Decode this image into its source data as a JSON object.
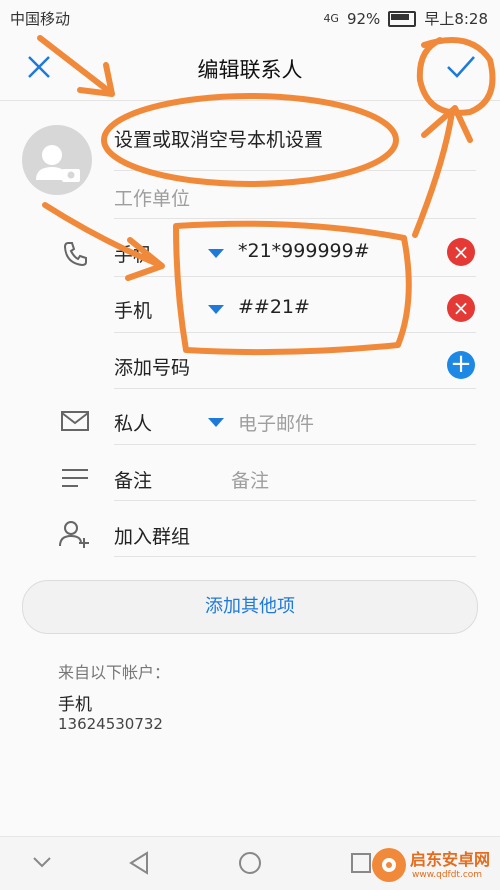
{
  "status_bar": {
    "carrier": "中国移动",
    "network": "4G",
    "battery": "92%",
    "time": "早上8:28"
  },
  "header": {
    "title": "编辑联系人"
  },
  "form": {
    "name_value": "设置或取消空号本机设置",
    "company_placeholder": "工作单位",
    "phones": [
      {
        "type": "手机",
        "number": "*21*999999#"
      },
      {
        "type": "手机",
        "number": "##21#"
      }
    ],
    "add_number_label": "添加号码",
    "email": {
      "type": "私人",
      "placeholder": "电子邮件"
    },
    "note": {
      "label": "备注",
      "placeholder": "备注"
    },
    "group_label": "加入群组",
    "add_other_label": "添加其他项"
  },
  "account": {
    "heading": "来自以下帐户：",
    "type": "手机",
    "number": "13624530732"
  },
  "watermark": {
    "brand": "启东安卓网",
    "url": "www.qdfdt.com"
  },
  "colors": {
    "accent": "#1e7ad8",
    "annotation": "#f08a3a",
    "remove": "#e53935"
  },
  "icons": [
    "close-icon",
    "check-icon",
    "camera-icon",
    "phone-icon",
    "mail-icon",
    "note-icon",
    "group-icon"
  ]
}
